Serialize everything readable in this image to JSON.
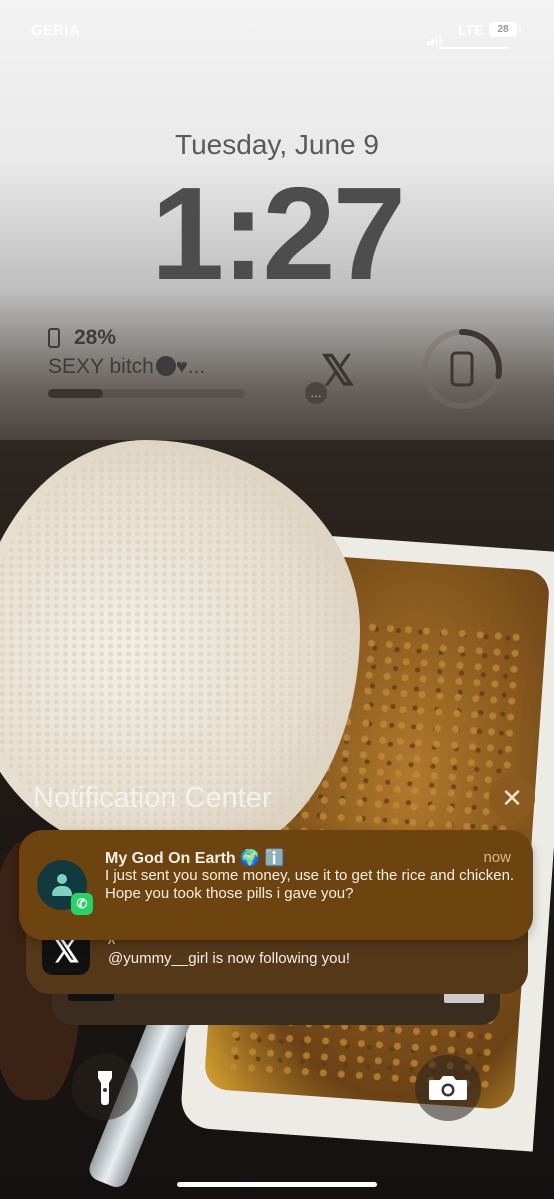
{
  "status_bar": {
    "carrier": "GERIA",
    "network": "LTE",
    "battery": "28"
  },
  "lock_screen": {
    "date": "Tuesday, June 9",
    "time": "1:27"
  },
  "widgets": {
    "battery_widget": {
      "percent_label": "28%",
      "device_name": "SEXY bitch",
      "trailing": "...",
      "level": 0.28
    },
    "x_widget": {
      "icon": "x-logo-icon",
      "badge_icon": "chat-bubble-icon"
    },
    "battery_ring": {
      "icon": "phone-icon",
      "level": 0.28
    }
  },
  "notification_center": {
    "title": "Notification Center",
    "close_icon": "close-icon"
  },
  "notifications": [
    {
      "app": "WhatsApp",
      "title": "My God On Earth 🌍 ℹ️",
      "time": "now",
      "body_line1": "I just sent you some money, use it to get the rice and chicken.",
      "body_line2": "Hope you took those pills i gave you?"
    },
    {
      "app": "X",
      "caret": "^",
      "body": "@yummy__girl is now following you!"
    }
  ],
  "bottom_controls": {
    "flashlight_icon": "flashlight-icon",
    "camera_icon": "camera-icon"
  },
  "colors": {
    "notification_bg": "#6d4410",
    "close_button": "#8a5a1e",
    "whatsapp": "#25d366"
  }
}
